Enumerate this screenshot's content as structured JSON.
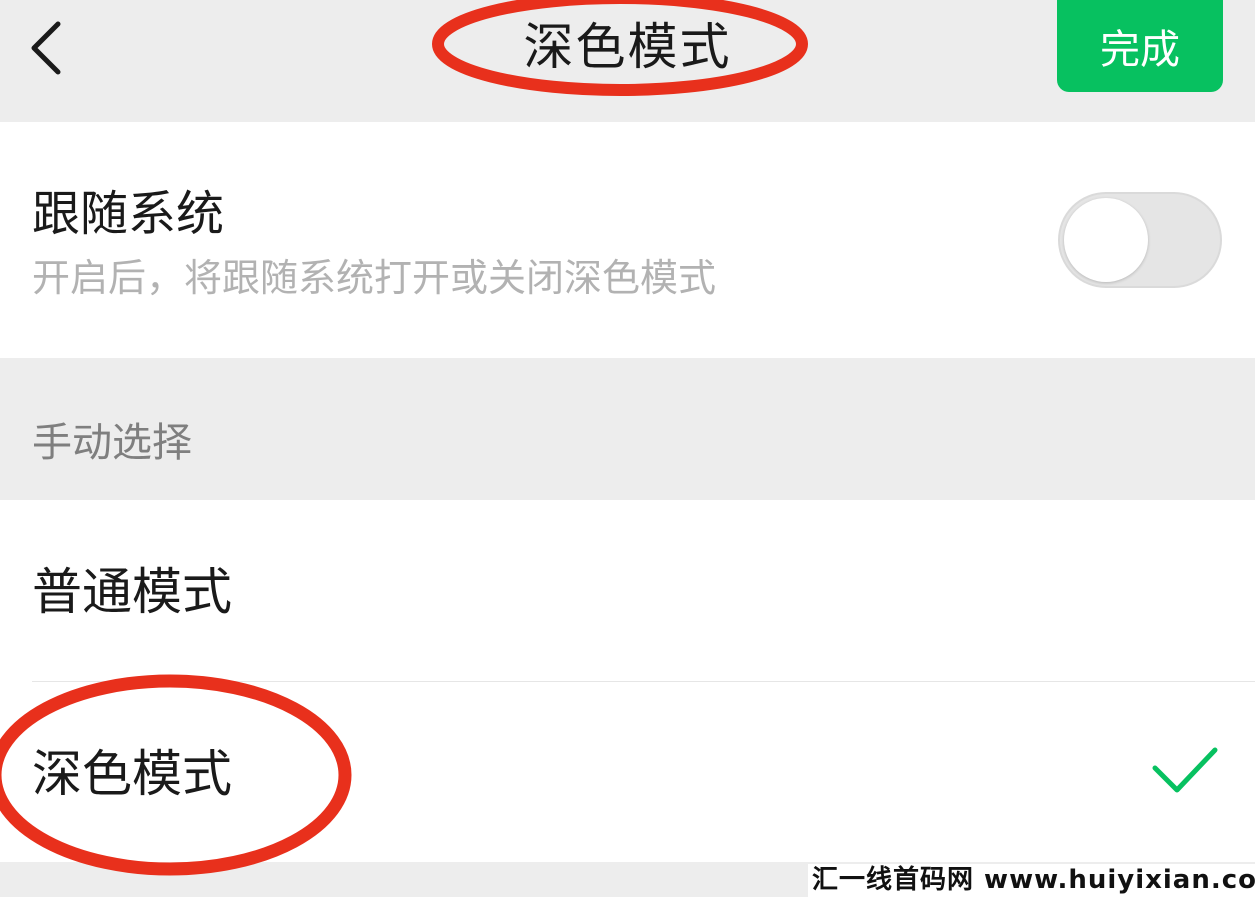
{
  "header": {
    "title": "深色模式",
    "done_label": "完成",
    "back_icon": "chevron-left-icon"
  },
  "follow_system": {
    "title": "跟随系统",
    "description": "开启后，将跟随系统打开或关闭深色模式",
    "toggle_on": false
  },
  "manual": {
    "section_label": "手动选择",
    "options": [
      {
        "label": "普通模式",
        "selected": false
      },
      {
        "label": "深色模式",
        "selected": true
      }
    ]
  },
  "watermark": {
    "text": "汇一线首码网 www.huiyixian.com"
  },
  "colors": {
    "accent": "#07c160",
    "annotation": "#e8301c",
    "background": "#ededed"
  }
}
